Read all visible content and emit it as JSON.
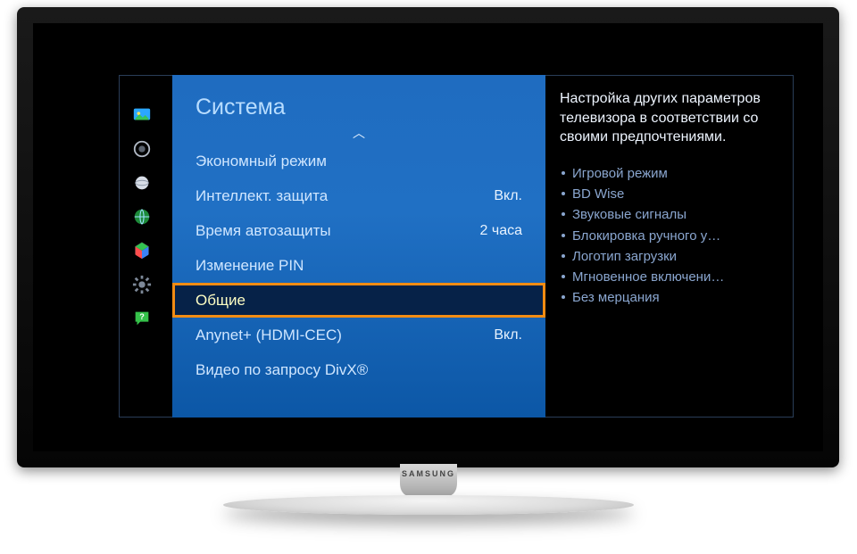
{
  "brand": "SAMSUNG",
  "sidebar": {
    "items": [
      {
        "name": "picture-icon"
      },
      {
        "name": "sound-icon"
      },
      {
        "name": "broadcast-icon"
      },
      {
        "name": "network-icon"
      },
      {
        "name": "smart-icon"
      },
      {
        "name": "system-icon"
      },
      {
        "name": "support-icon"
      }
    ]
  },
  "menu": {
    "title": "Система",
    "rows": [
      {
        "label": "Экономный режим",
        "value": "",
        "selected": false
      },
      {
        "label": "Интеллект. защита",
        "value": "Вкл.",
        "selected": false
      },
      {
        "label": "Время автозащиты",
        "value": "2 часа",
        "selected": false
      },
      {
        "label": "Изменение PIN",
        "value": "",
        "selected": false
      },
      {
        "label": "Общие",
        "value": "",
        "selected": true
      },
      {
        "label": "Anynet+ (HDMI-CEC)",
        "value": "Вкл.",
        "selected": false
      },
      {
        "label": "Видео по запросу DivX®",
        "value": "",
        "selected": false
      }
    ]
  },
  "description": {
    "text": "Настройка других параметров телевизора в соответствии со своими предпочтениями.",
    "bullets": [
      "Игровой режим",
      "BD Wise",
      "Звуковые сигналы",
      "Блокировка ручного у…",
      "Логотип загрузки",
      "Мгновенное включени…",
      "Без мерцания"
    ]
  },
  "colors": {
    "panel_top": "#1f6cc0",
    "panel_bottom": "#0c57a6",
    "highlight_bg": "#062248",
    "highlight_border": "#f28c13",
    "highlight_text": "#fdfdc3"
  }
}
